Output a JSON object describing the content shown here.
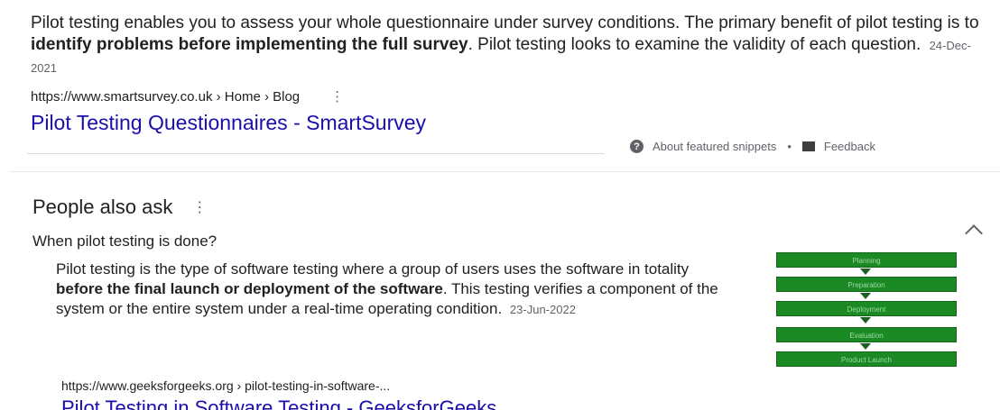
{
  "snippet": {
    "part1": "Pilot testing enables you to assess your whole questionnaire under survey conditions. The primary benefit of pilot testing is to ",
    "bold": "identify problems before implementing the full survey",
    "part2": ". Pilot testing looks to examine the validity of each question.",
    "date": "24-Dec-2021"
  },
  "result1": {
    "cite": "https://www.smartsurvey.co.uk › Home › Blog",
    "menu_dots": "⋮",
    "title": "Pilot Testing Questionnaires - SmartSurvey"
  },
  "snippet_footer": {
    "help_glyph": "?",
    "about_label": "About featured snippets",
    "separator": "•",
    "feedback_label": "Feedback"
  },
  "paa": {
    "heading": "People also ask",
    "menu_dots": "⋮",
    "question": "When pilot testing is done?",
    "answer_part1": "Pilot testing is the type of software testing where a group of users uses the software in totality ",
    "answer_bold": "before the final launch or deployment of the software",
    "answer_part2": ". This testing verifies a component of the system or the entire system under a real-time operating condition.",
    "answer_date": "23-Jun-2022",
    "flow_steps": [
      "Planning",
      "Preparation",
      "Deployment",
      "Evaluation",
      "Product Launch"
    ]
  },
  "result2": {
    "cite": "https://www.geeksforgeeks.org › pilot-testing-in-software-...",
    "title": "Pilot Testing in Software Testing - GeeksforGeeks"
  },
  "colors": {
    "link": "#1a0dab",
    "flow_green": "#1b8a24"
  },
  "icons": {
    "help": "help-circle-icon",
    "feedback": "flag-icon",
    "chevron": "chevron-up-icon"
  }
}
